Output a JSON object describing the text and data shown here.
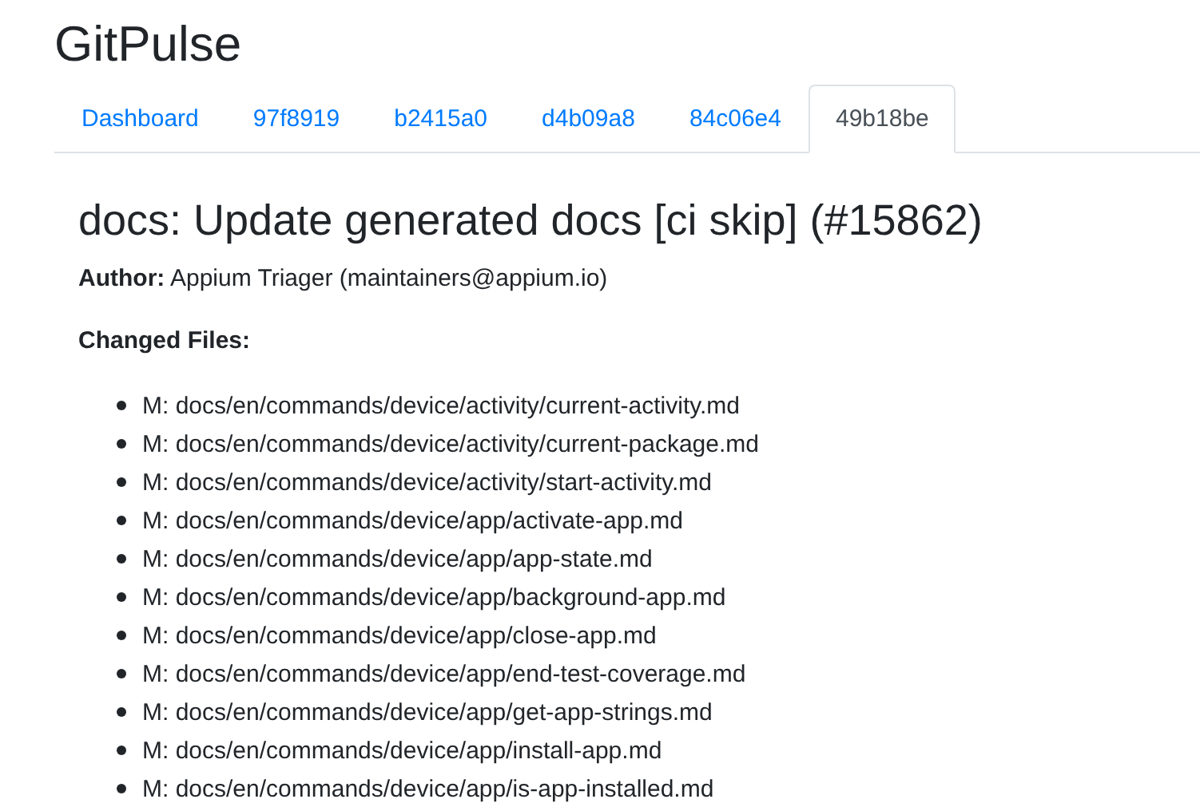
{
  "app_title": "GitPulse",
  "tabs": [
    {
      "label": "Dashboard",
      "selected": false
    },
    {
      "label": "97f8919",
      "selected": false
    },
    {
      "label": "b2415a0",
      "selected": false
    },
    {
      "label": "d4b09a8",
      "selected": false
    },
    {
      "label": "84c06e4",
      "selected": false
    },
    {
      "label": "49b18be",
      "selected": true
    }
  ],
  "commit": {
    "title": "docs: Update generated docs [ci skip] (#15862)",
    "author": "**Author:** Appium Triager (maintainers@appium.io)",
    "changed_files_heading": "Changed Files:",
    "files": [
      "M: docs/en/commands/device/activity/current-activity.md",
      "M: docs/en/commands/device/activity/current-package.md",
      "M: docs/en/commands/device/activity/start-activity.md",
      "M: docs/en/commands/device/app/activate-app.md",
      "M: docs/en/commands/device/app/app-state.md",
      "M: docs/en/commands/device/app/background-app.md",
      "M: docs/en/commands/device/app/close-app.md",
      "M: docs/en/commands/device/app/end-test-coverage.md",
      "M: docs/en/commands/device/app/get-app-strings.md",
      "M: docs/en/commands/device/app/install-app.md",
      "M: docs/en/commands/device/app/is-app-installed.md"
    ]
  }
}
